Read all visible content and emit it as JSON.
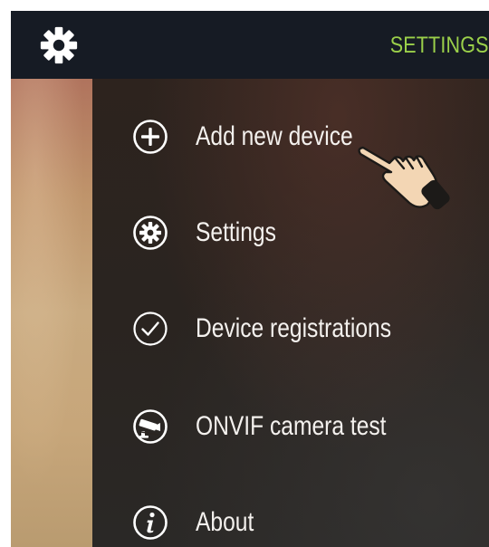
{
  "header": {
    "title": "SETTINGS",
    "menu_icon": "gear-icon",
    "title_color": "#9bd04a",
    "bar_color": "#161b24"
  },
  "menu": {
    "items": [
      {
        "label": "Add new device",
        "icon": "plus-circle-icon"
      },
      {
        "label": "Settings",
        "icon": "gear-circle-icon"
      },
      {
        "label": "Device registrations",
        "icon": "check-circle-icon"
      },
      {
        "label": "ONVIF camera test",
        "icon": "camera-circle-icon"
      },
      {
        "label": "About",
        "icon": "info-circle-icon"
      }
    ]
  },
  "pointer_icon": "pointing-hand-icon"
}
